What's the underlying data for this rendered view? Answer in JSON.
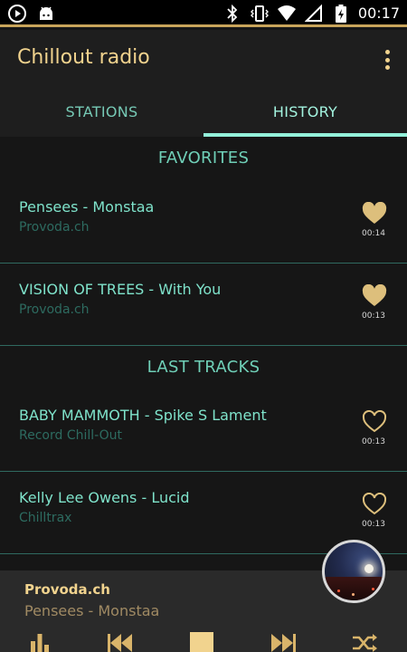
{
  "statusbar": {
    "time": "00:17"
  },
  "appbar": {
    "title": "Chillout radio"
  },
  "tabs": [
    {
      "label": "STATIONS",
      "active": false
    },
    {
      "label": "HISTORY",
      "active": true
    }
  ],
  "favorites": {
    "header": "FAVORITES",
    "items": [
      {
        "title": "Pensees - Monstaa",
        "station": "Provoda.ch",
        "time": "00:14",
        "favorite": true
      },
      {
        "title": "VISION OF TREES - With You",
        "station": "Provoda.ch",
        "time": "00:13",
        "favorite": true
      }
    ]
  },
  "last_tracks": {
    "header": "LAST TRACKS",
    "items": [
      {
        "title": "BABY MAMMOTH - Spike S Lament",
        "station": "Record Chill-Out",
        "time": "00:13",
        "favorite": false
      },
      {
        "title": "Kelly Lee Owens - Lucid",
        "station": "Chilltrax",
        "time": "00:13",
        "favorite": false
      }
    ]
  },
  "player": {
    "station": "Provoda.ch",
    "track": "Pensees - Monstaa"
  },
  "colors": {
    "accent": "#f1d38e",
    "teal": "#7fe3cb",
    "background": "#161616"
  }
}
